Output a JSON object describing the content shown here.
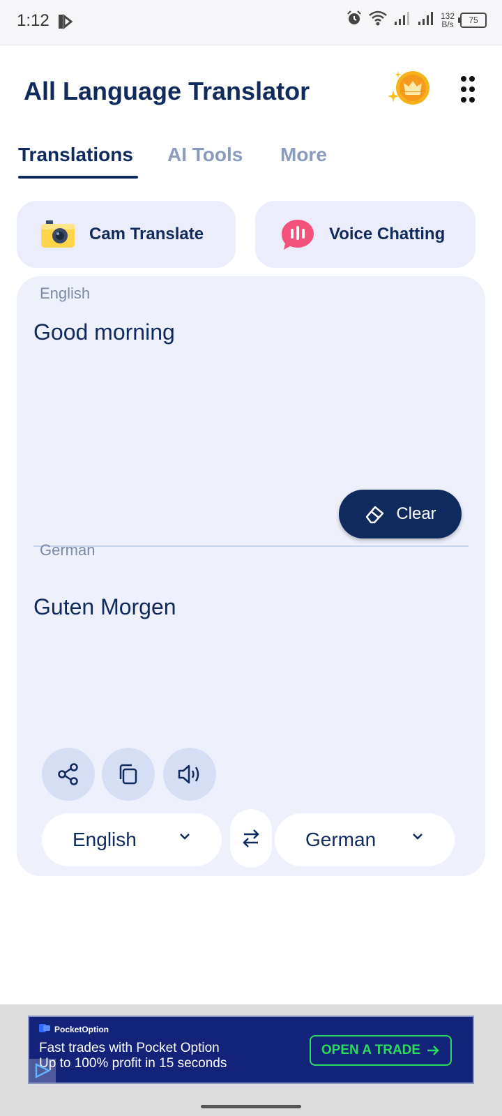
{
  "status_bar": {
    "time": "1:12",
    "network_speed_value": "132",
    "network_speed_unit": "B/s",
    "battery": "75",
    "icons": [
      "alarm-icon",
      "wifi-icon",
      "signal-icon",
      "signal-icon",
      "battery-icon"
    ]
  },
  "header": {
    "title": "All Language Translator",
    "premium_icon": "crown-coin-icon",
    "menu_icon": "more-dots-icon"
  },
  "tabs": [
    {
      "label": "Translations",
      "active": true
    },
    {
      "label": "AI Tools",
      "active": false
    },
    {
      "label": "More",
      "active": false
    }
  ],
  "actions": {
    "cam": {
      "label": "Cam Translate",
      "icon": "camera-icon"
    },
    "voice": {
      "label": "Voice Chatting",
      "icon": "voice-chat-icon"
    }
  },
  "translator": {
    "source_caption": "English",
    "source_text": "Good morning",
    "clear_label": "Clear",
    "target_caption": "German",
    "target_text": "Guten Morgen",
    "tools": [
      "share-icon",
      "copy-icon",
      "speaker-icon"
    ],
    "source_language": "English",
    "target_language": "German"
  },
  "ad": {
    "brand": "PocketOption",
    "line1": "Fast trades with Pocket Option",
    "line2": "Up to 100% profit in 15 seconds",
    "cta": "OPEN A TRADE"
  },
  "colors": {
    "primary": "#0f2a5c",
    "panel": "#eef0fc",
    "accent_card": "#ecedfb",
    "ad_background": "#13237a",
    "ad_cta": "#2bdc5c"
  }
}
